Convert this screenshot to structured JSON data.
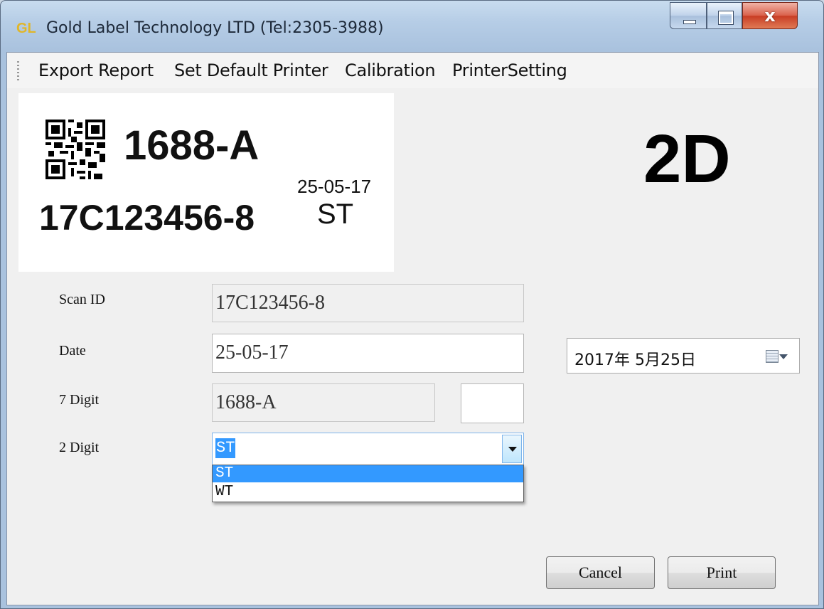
{
  "window": {
    "title": "Gold Label Technology LTD (Tel:2305-3988)",
    "icon_text": "GL",
    "close_glyph": "x"
  },
  "menu": {
    "items": [
      "Export Report",
      "Set Default Printer",
      "Calibration",
      "PrinterSetting"
    ]
  },
  "preview": {
    "code": "1688-A",
    "date": "25-05-17",
    "scan_id": "17C123456-8",
    "digit2": "ST",
    "qr_icon": "qr-code-icon"
  },
  "mode": "2D",
  "form": {
    "scan_id": {
      "label": "Scan ID",
      "value": "17C123456-8"
    },
    "date": {
      "label": "Date",
      "value": "25-05-17"
    },
    "digit7": {
      "label": "7 Digit",
      "value": "1688-A",
      "extra_value": ""
    },
    "digit2": {
      "label": "2 Digit",
      "value": "ST",
      "options": [
        "ST",
        "WT"
      ],
      "selected": "ST"
    }
  },
  "datepicker": {
    "value": "2017年  5月25日",
    "icon": "calendar-icon"
  },
  "buttons": {
    "cancel": "Cancel",
    "print": "Print"
  },
  "colors": {
    "selection": "#3399ff",
    "close_button": "#c83c24",
    "logo": "#e0b62a"
  }
}
